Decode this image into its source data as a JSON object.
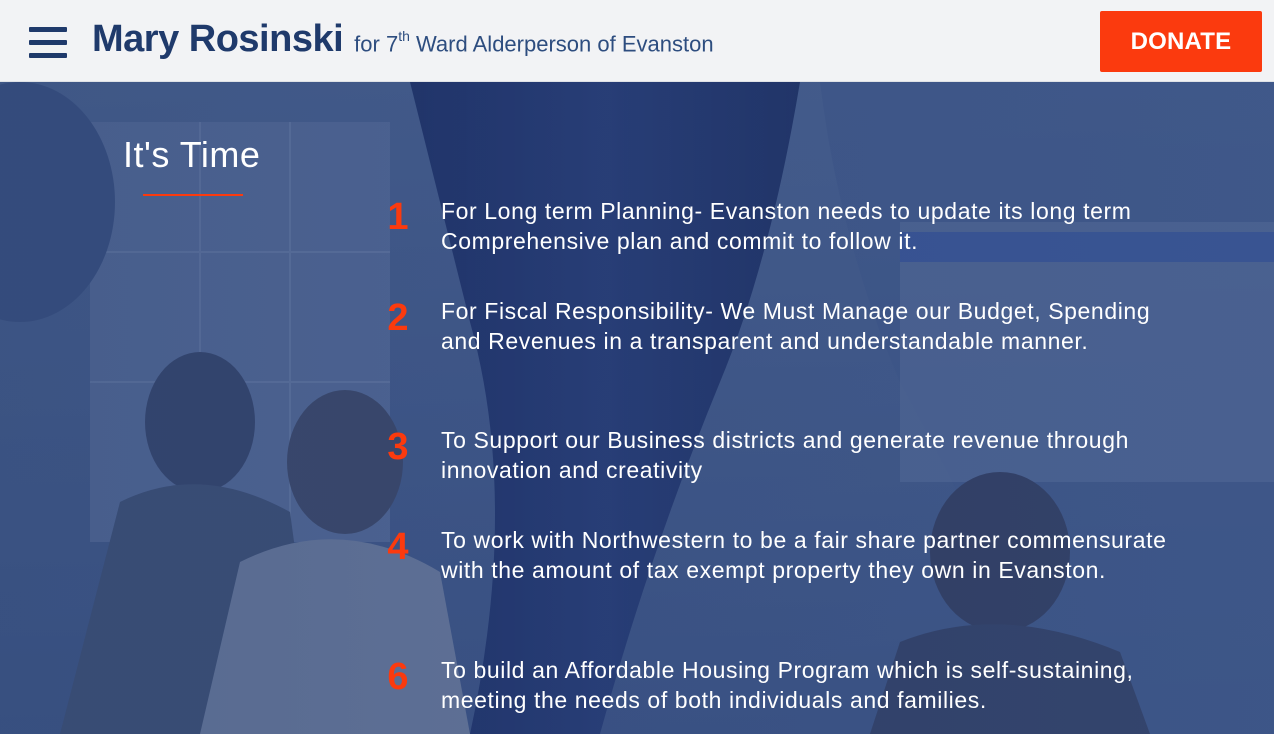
{
  "header": {
    "menu_icon": "hamburger-menu-icon",
    "brand_name": "Mary Rosinski",
    "brand_sub_prefix": "for 7",
    "brand_sub_sup": "th",
    "brand_sub_suffix": " Ward Alderperson of Evanston",
    "donate_label": "DONATE"
  },
  "hero": {
    "title": "It's Time",
    "items": [
      {
        "number": "1",
        "text": "For Long term Planning- Evanston needs to update its long term Comprehensive plan and commit to follow it."
      },
      {
        "number": "2",
        "text": "For Fiscal Responsibility- We Must Manage our Budget, Spending and Revenues in a transparent and understandable manner."
      },
      {
        "number": "3",
        "text": "To Support our Business districts and generate revenue through innovation and creativity"
      },
      {
        "number": "4",
        "text": "To work with Northwestern to be a fair share partner commensurate with the amount of tax exempt property they own in Evanston."
      },
      {
        "number": "6",
        "text": "To build an Affordable Housing Program which is self-sustaining, meeting the needs of both individuals and families."
      }
    ]
  },
  "colors": {
    "brand_blue": "#1f3a6b",
    "accent_orange": "#fb3a0e",
    "header_bg": "#f2f3f5",
    "overlay_blue": "#2c4a80"
  }
}
